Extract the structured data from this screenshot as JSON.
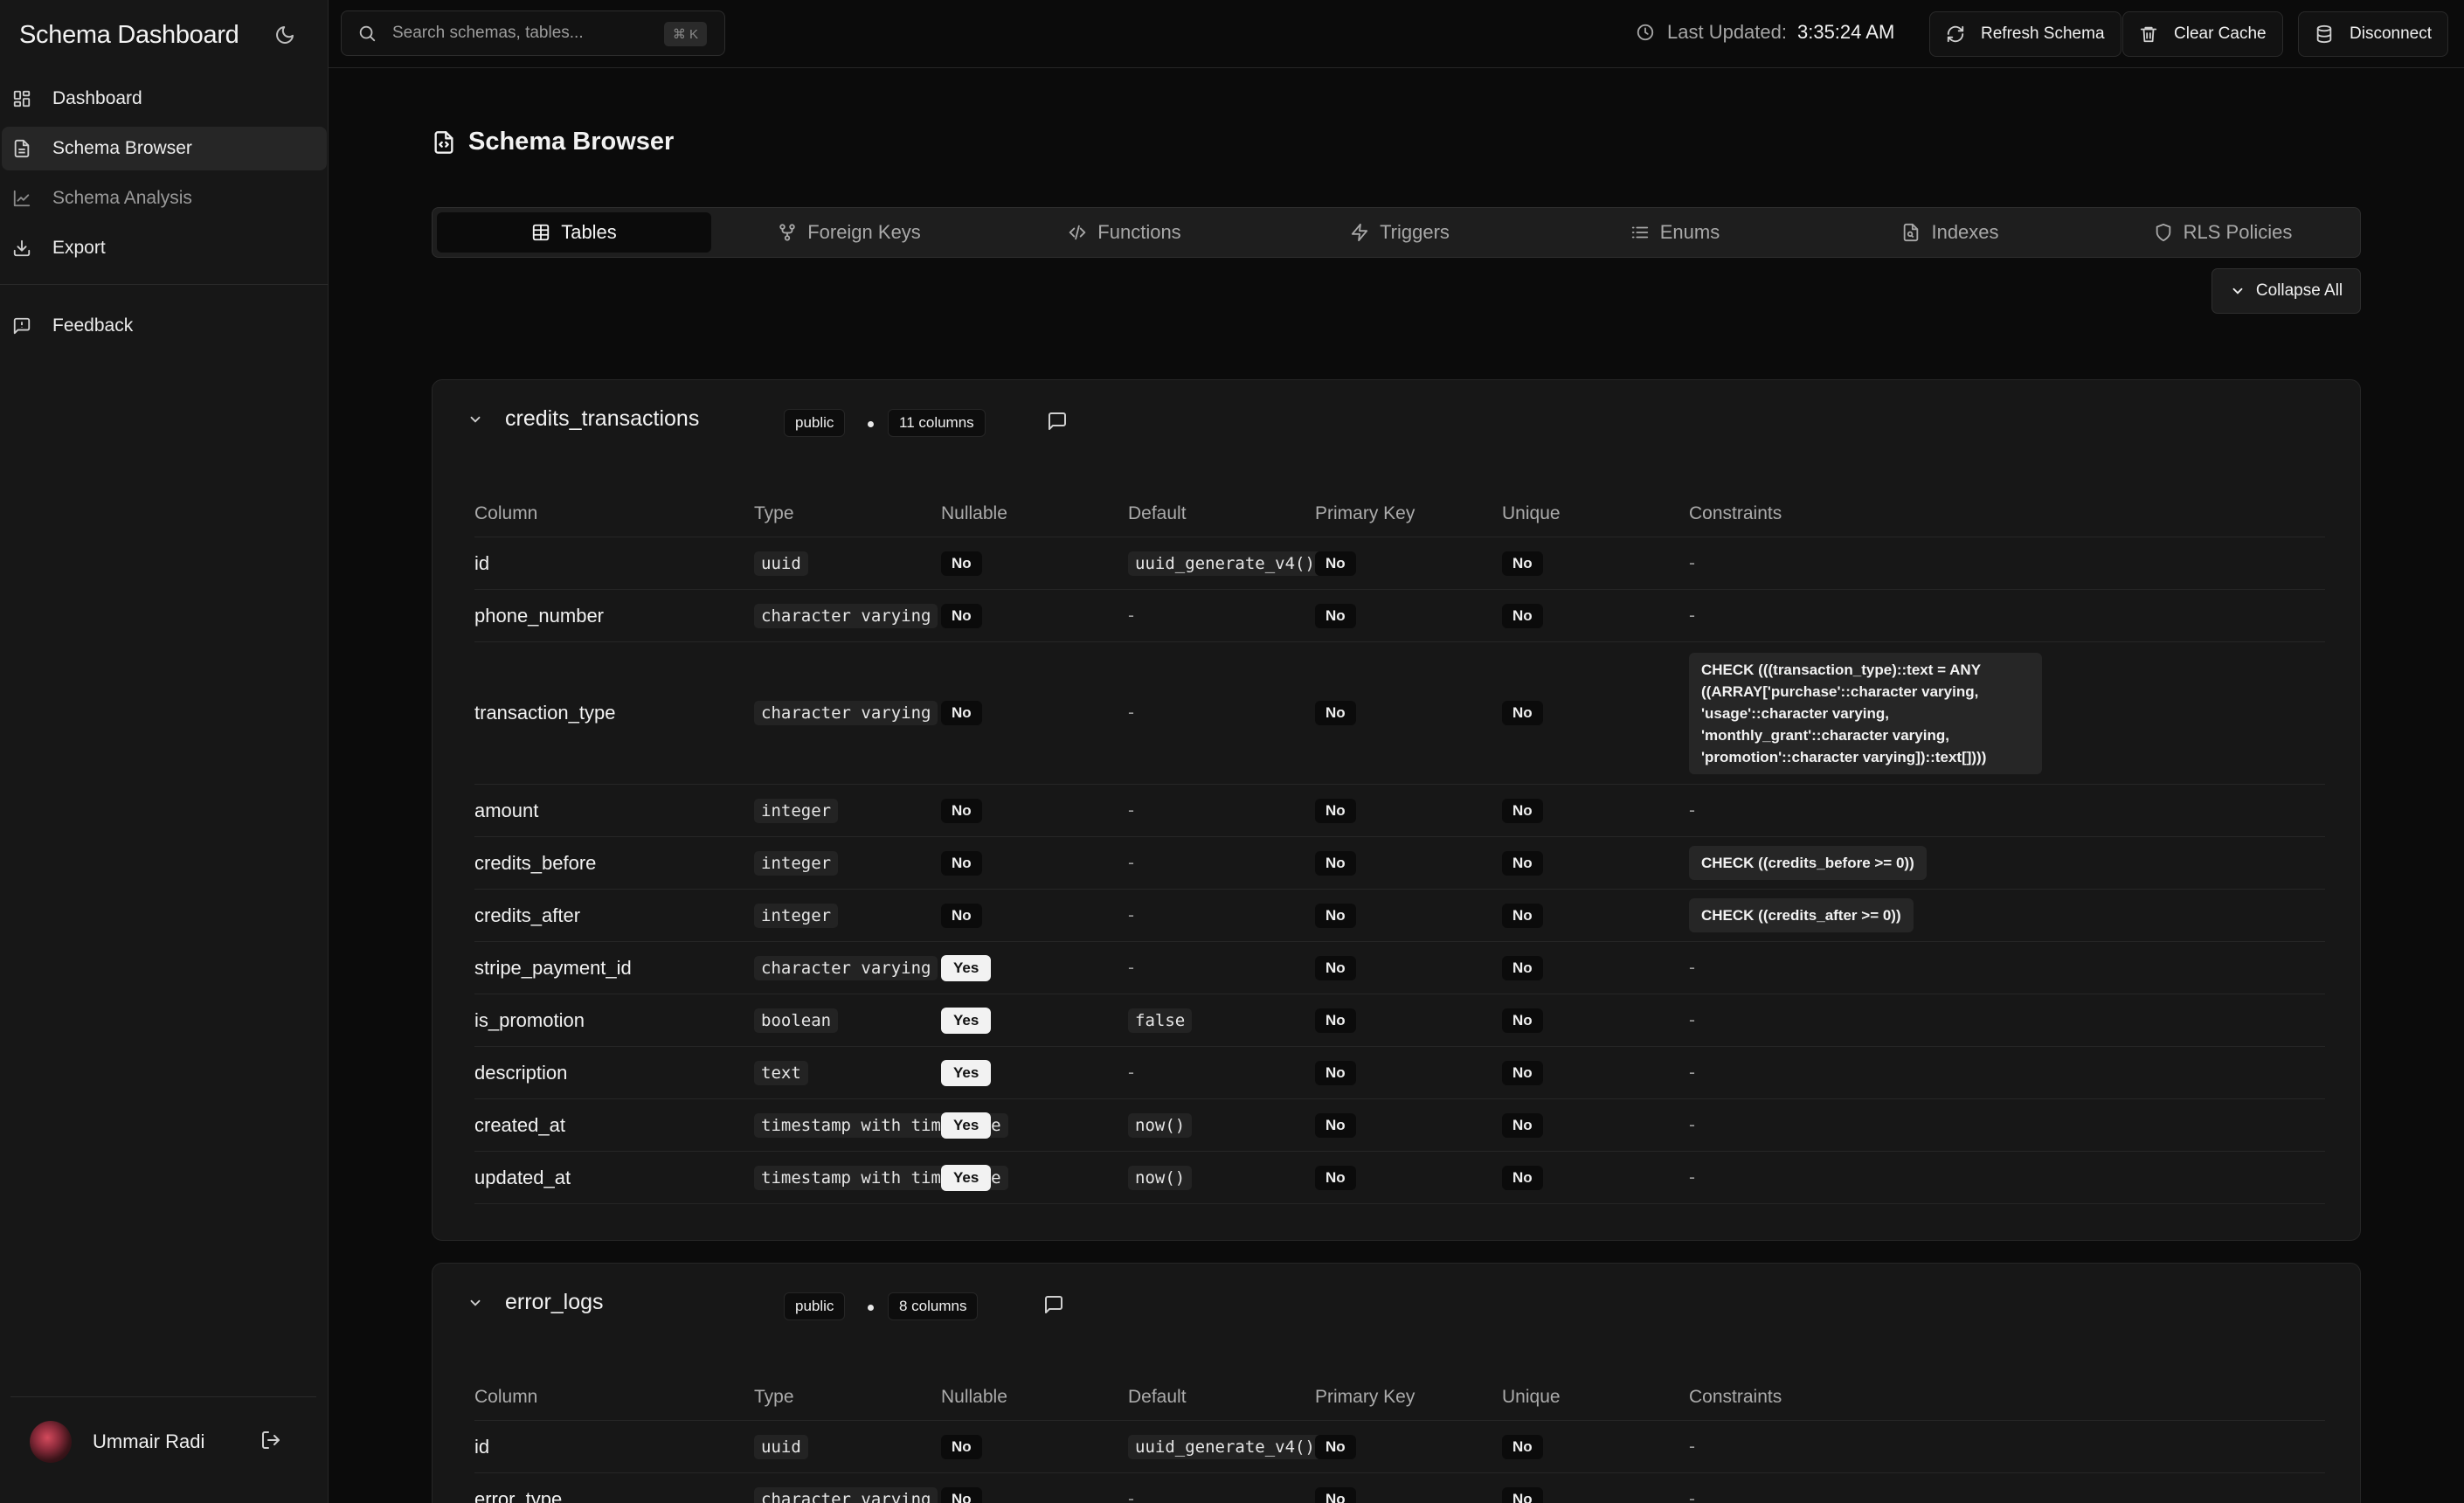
{
  "sidebar": {
    "app_title": "Schema Dashboard",
    "nav": [
      "Dashboard",
      "Schema Browser",
      "Schema Analysis",
      "Export"
    ],
    "feedback": "Feedback",
    "user": {
      "name": "Ummair Radi"
    }
  },
  "topbar": {
    "search_placeholder": "Search schemas, tables...",
    "shortcut": "⌘ K",
    "last_updated_label": "Last Updated:",
    "last_updated_value": "3:35:24 AM",
    "refresh": "Refresh Schema",
    "clear_cache": "Clear Cache",
    "disconnect": "Disconnect"
  },
  "page": {
    "title": "Schema Browser"
  },
  "tabs": [
    "Tables",
    "Foreign Keys",
    "Functions",
    "Triggers",
    "Enums",
    "Indexes",
    "RLS Policies"
  ],
  "active_tab": "Tables",
  "collapse_all": "Collapse All",
  "columns_header": [
    "Column",
    "Type",
    "Nullable",
    "Default",
    "Primary Key",
    "Unique",
    "Constraints"
  ],
  "tables": [
    {
      "name": "credits_transactions",
      "schema": "public",
      "columns_count": "11 columns",
      "rows": [
        {
          "name": "id",
          "type": "uuid",
          "nullable": "No",
          "default": "uuid_generate_v4()",
          "pk": "No",
          "unique": "No",
          "constraints": "-"
        },
        {
          "name": "phone_number",
          "type": "character varying",
          "nullable": "No",
          "default": "-",
          "pk": "No",
          "unique": "No",
          "constraints": "-"
        },
        {
          "name": "transaction_type",
          "type": "character varying",
          "nullable": "No",
          "default": "-",
          "pk": "No",
          "unique": "No",
          "constraints": "CHECK (((transaction_type)::text = ANY ((ARRAY['purchase'::character varying, 'usage'::character varying, 'monthly_grant'::character varying, 'promotion'::character varying])::text[])))"
        },
        {
          "name": "amount",
          "type": "integer",
          "nullable": "No",
          "default": "-",
          "pk": "No",
          "unique": "No",
          "constraints": "-"
        },
        {
          "name": "credits_before",
          "type": "integer",
          "nullable": "No",
          "default": "-",
          "pk": "No",
          "unique": "No",
          "constraints": "CHECK ((credits_before >= 0))"
        },
        {
          "name": "credits_after",
          "type": "integer",
          "nullable": "No",
          "default": "-",
          "pk": "No",
          "unique": "No",
          "constraints": "CHECK ((credits_after >= 0))"
        },
        {
          "name": "stripe_payment_id",
          "type": "character varying",
          "nullable": "Yes",
          "default": "-",
          "pk": "No",
          "unique": "No",
          "constraints": "-"
        },
        {
          "name": "is_promotion",
          "type": "boolean",
          "nullable": "Yes",
          "default": "false",
          "pk": "No",
          "unique": "No",
          "constraints": "-"
        },
        {
          "name": "description",
          "type": "text",
          "nullable": "Yes",
          "default": "-",
          "pk": "No",
          "unique": "No",
          "constraints": "-"
        },
        {
          "name": "created_at",
          "type": "timestamp with time zone",
          "nullable": "Yes",
          "default": "now()",
          "pk": "No",
          "unique": "No",
          "constraints": "-"
        },
        {
          "name": "updated_at",
          "type": "timestamp with time zone",
          "nullable": "Yes",
          "default": "now()",
          "pk": "No",
          "unique": "No",
          "constraints": "-"
        }
      ]
    },
    {
      "name": "error_logs",
      "schema": "public",
      "columns_count": "8 columns",
      "rows": [
        {
          "name": "id",
          "type": "uuid",
          "nullable": "No",
          "default": "uuid_generate_v4()",
          "pk": "No",
          "unique": "No",
          "constraints": "-"
        },
        {
          "name": "error_type",
          "type": "character varying",
          "nullable": "No",
          "default": "-",
          "pk": "No",
          "unique": "No",
          "constraints": "-"
        }
      ]
    }
  ]
}
